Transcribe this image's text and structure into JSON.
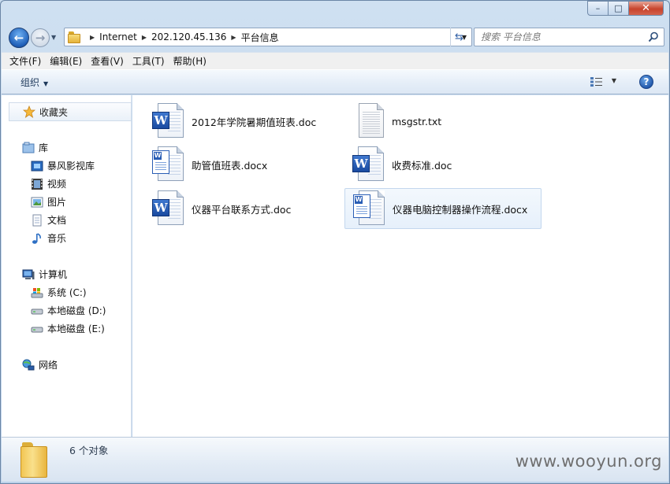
{
  "window": {
    "controls": {
      "minimize": "–",
      "maximize": "□",
      "close": "✕"
    }
  },
  "address": {
    "breadcrumbs": [
      "Internet",
      "202.120.45.136",
      "平台信息"
    ]
  },
  "search": {
    "placeholder": "搜索 平台信息"
  },
  "menu": [
    "文件(F)",
    "编辑(E)",
    "查看(V)",
    "工具(T)",
    "帮助(H)"
  ],
  "toolbar": {
    "organize_label": "组织",
    "help_label": "?"
  },
  "sidebar": {
    "favorites": {
      "label": "收藏夹"
    },
    "libraries": {
      "label": "库",
      "items": [
        "暴风影视库",
        "视频",
        "图片",
        "文档",
        "音乐"
      ]
    },
    "computer": {
      "label": "计算机",
      "items": [
        "系统 (C:)",
        "本地磁盘 (D:)",
        "本地磁盘 (E:)"
      ]
    },
    "network": {
      "label": "网络"
    }
  },
  "files": [
    {
      "name": "2012年学院暑期值班表.doc",
      "type": "doc",
      "selected": false
    },
    {
      "name": "msgstr.txt",
      "type": "txt",
      "selected": false
    },
    {
      "name": "助管值班表.docx",
      "type": "docx",
      "selected": false
    },
    {
      "name": "收费标准.doc",
      "type": "doc",
      "selected": false
    },
    {
      "name": "仪器平台联系方式.doc",
      "type": "doc",
      "selected": false
    },
    {
      "name": "仪器电脑控制器操作流程.docx",
      "type": "docx",
      "selected": true
    }
  ],
  "details": {
    "count_text": "6 个对象"
  },
  "watermark": "www.wooyun.org",
  "colors": {
    "accent": "#1f55a8",
    "selection": "#e6f0fb"
  }
}
